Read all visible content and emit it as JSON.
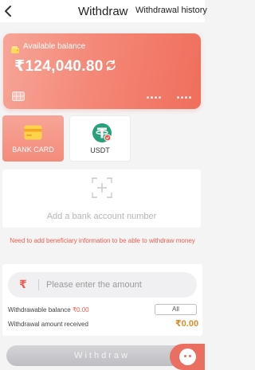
{
  "header": {
    "title": "Withdraw",
    "history_label": "Withdrawal history"
  },
  "balance_card": {
    "label": "Available balance",
    "amount": "₹124,040.80"
  },
  "methods": [
    {
      "label": "BANK CARD",
      "selected": true
    },
    {
      "label": "USDT",
      "selected": false
    }
  ],
  "add_bank": {
    "label": "Add a bank account number"
  },
  "notice": "Need to add beneficiary information to be able to withdraw money",
  "amount": {
    "currency_symbol": "₹",
    "placeholder": "Please enter the amount",
    "value": "",
    "withdrawable_label": "Withdrawable balance",
    "withdrawable_value": "₹0.00",
    "all_label": "All",
    "received_label": "Withdrawal amount received",
    "received_value": "₹0.00"
  },
  "withdraw_button": "Withdraw",
  "colors": {
    "accent": "#ef5c4e",
    "card_gradient_start": "#f7a597",
    "card_gradient_end": "#f06e5c",
    "received_amount": "#e0892c",
    "disabled_button": "#c9c9ce"
  },
  "icons": [
    "back-icon",
    "wallet-icon",
    "refresh-icon",
    "chip-icon",
    "bank-card-icon",
    "usdt-icon",
    "add-icon",
    "customer-service-icon"
  ]
}
